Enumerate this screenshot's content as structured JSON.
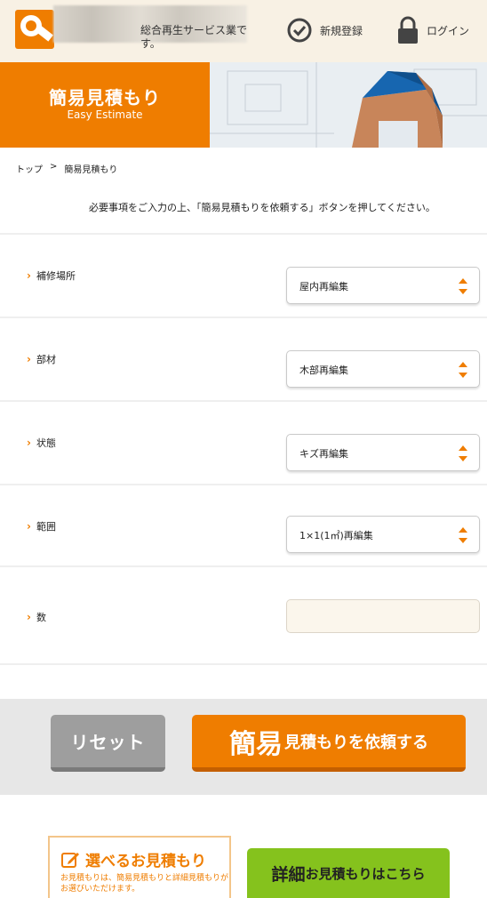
{
  "header": {
    "tagline": "総合再生サービス業です。",
    "register_label": "新規登録",
    "login_label": "ログイン"
  },
  "banner": {
    "title": "簡易見積もり",
    "subtitle": "Easy Estimate"
  },
  "breadcrumb": {
    "home": "トップ",
    "separator": ">",
    "current": "簡易見積もり"
  },
  "lead": "必要事項をご入力の上、「簡易見積もりを依頼する」ボタンを押してください。",
  "form": {
    "location": {
      "label": "補修場所",
      "value": "屋内再編集"
    },
    "material": {
      "label": "部材",
      "value": "木部再編集"
    },
    "condition": {
      "label": "状態",
      "value": "キズ再編集"
    },
    "range": {
      "label": "範囲",
      "value": "1×1(1㎡)再編集"
    },
    "quantity": {
      "label": "数",
      "value": ""
    }
  },
  "buttons": {
    "reset": "リセット",
    "submit_big": "簡易",
    "submit_rest": "見積もりを依頼する"
  },
  "promo": {
    "title": "選べるお見積もり",
    "desc": "お見積もりは、簡易見積もりと詳細見積もりがお選びいただけます。",
    "detail_big": "詳細",
    "detail_rest": "お見積もりはこちら"
  },
  "colors": {
    "accent": "#ef7d00",
    "green": "#85c21d"
  }
}
